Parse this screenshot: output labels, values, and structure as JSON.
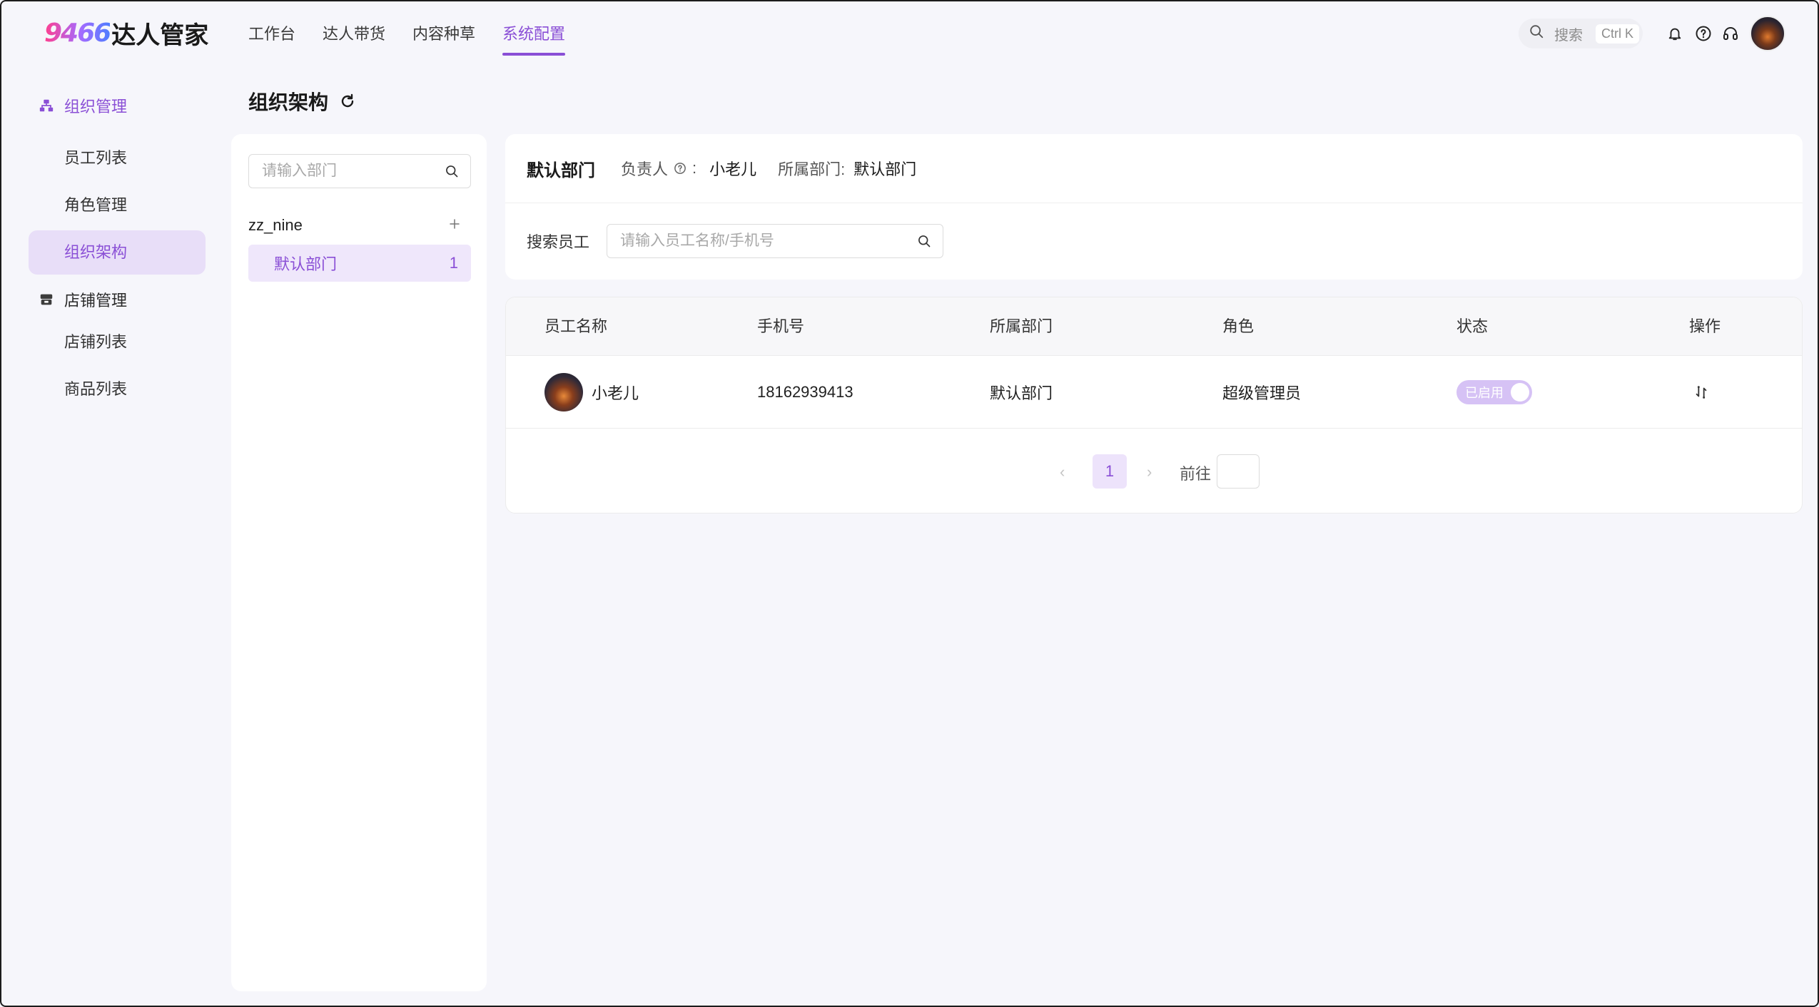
{
  "logo": {
    "number": "9466",
    "text": "达人管家"
  },
  "topnav": [
    {
      "label": "工作台"
    },
    {
      "label": "达人带货"
    },
    {
      "label": "内容种草"
    },
    {
      "label": "系统配置"
    }
  ],
  "header": {
    "search_label": "搜索",
    "shortcut": "Ctrl K"
  },
  "sidebar": {
    "org_group": "组织管理",
    "org_items": [
      {
        "label": "员工列表"
      },
      {
        "label": "角色管理"
      },
      {
        "label": "组织架构"
      }
    ],
    "shop_group": "店铺管理",
    "shop_items": [
      {
        "label": "店铺列表"
      },
      {
        "label": "商品列表"
      }
    ]
  },
  "page": {
    "title": "组织架构"
  },
  "dept_panel": {
    "search_placeholder": "请输入部门",
    "org_name": "zz_nine",
    "departments": [
      {
        "name": "默认部门",
        "count": "1"
      }
    ]
  },
  "info": {
    "dept_title": "默认部门",
    "owner_label": "负责人",
    "owner_sep": ":",
    "owner_value": "小老儿",
    "belong_label": "所属部门:",
    "belong_value": "默认部门",
    "emp_search_label": "搜索员工",
    "emp_search_placeholder": "请输入员工名称/手机号"
  },
  "table": {
    "columns": [
      "员工名称",
      "手机号",
      "所属部门",
      "角色",
      "状态",
      "操作"
    ],
    "rows": [
      {
        "name": "小老儿",
        "phone": "18162939413",
        "dept": "默认部门",
        "role": "超级管理员",
        "status": "已启用"
      }
    ]
  },
  "pagination": {
    "current": "1",
    "goto_label": "前往"
  },
  "colors": {
    "accent": "#8a4fd6",
    "active_bg": "#e8def8",
    "switch_bg": "#d6c2f5"
  }
}
